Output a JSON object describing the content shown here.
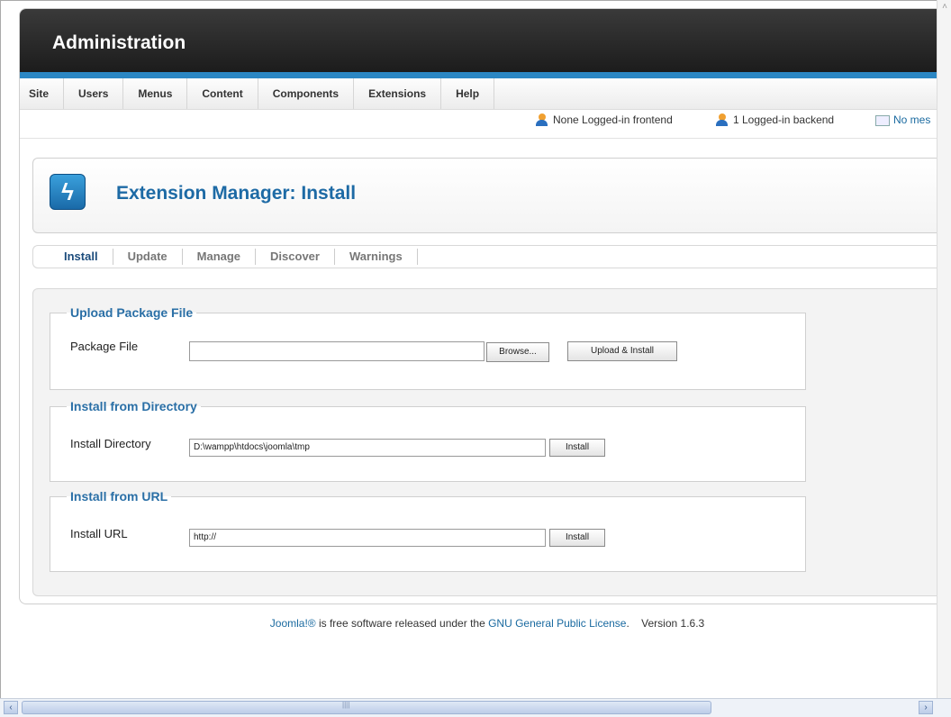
{
  "header": {
    "title": "Administration"
  },
  "menu": [
    "Site",
    "Users",
    "Menus",
    "Content",
    "Components",
    "Extensions",
    "Help"
  ],
  "status": {
    "frontend": "None Logged-in frontend",
    "backend": "1 Logged-in backend",
    "messages": "No mes"
  },
  "page": {
    "title": "Extension Manager: Install"
  },
  "tabs": [
    "Install",
    "Update",
    "Manage",
    "Discover",
    "Warnings"
  ],
  "upload": {
    "legend": "Upload Package File",
    "label": "Package File",
    "value": "",
    "browse_label": "Browse...",
    "submit_label": "Upload & Install"
  },
  "directory": {
    "legend": "Install from Directory",
    "label": "Install Directory",
    "value": "D:\\wampp\\htdocs\\joomla\\tmp",
    "submit_label": "Install"
  },
  "url": {
    "legend": "Install from URL",
    "label": "Install URL",
    "value": "http://",
    "submit_label": "Install"
  },
  "footer": {
    "brand": "Joomla!®",
    "text1": " is free software released under the ",
    "license": "GNU General Public License",
    "text2": ".    Version 1.6.3"
  },
  "colors": {
    "accent": "#2b87c4",
    "title": "#1d6aa5",
    "header_bg": "#2a2a2a"
  },
  "icons": [
    "extension-manager-bolt-icon",
    "user-frontend-icon",
    "user-backend-icon",
    "message-icon"
  ]
}
